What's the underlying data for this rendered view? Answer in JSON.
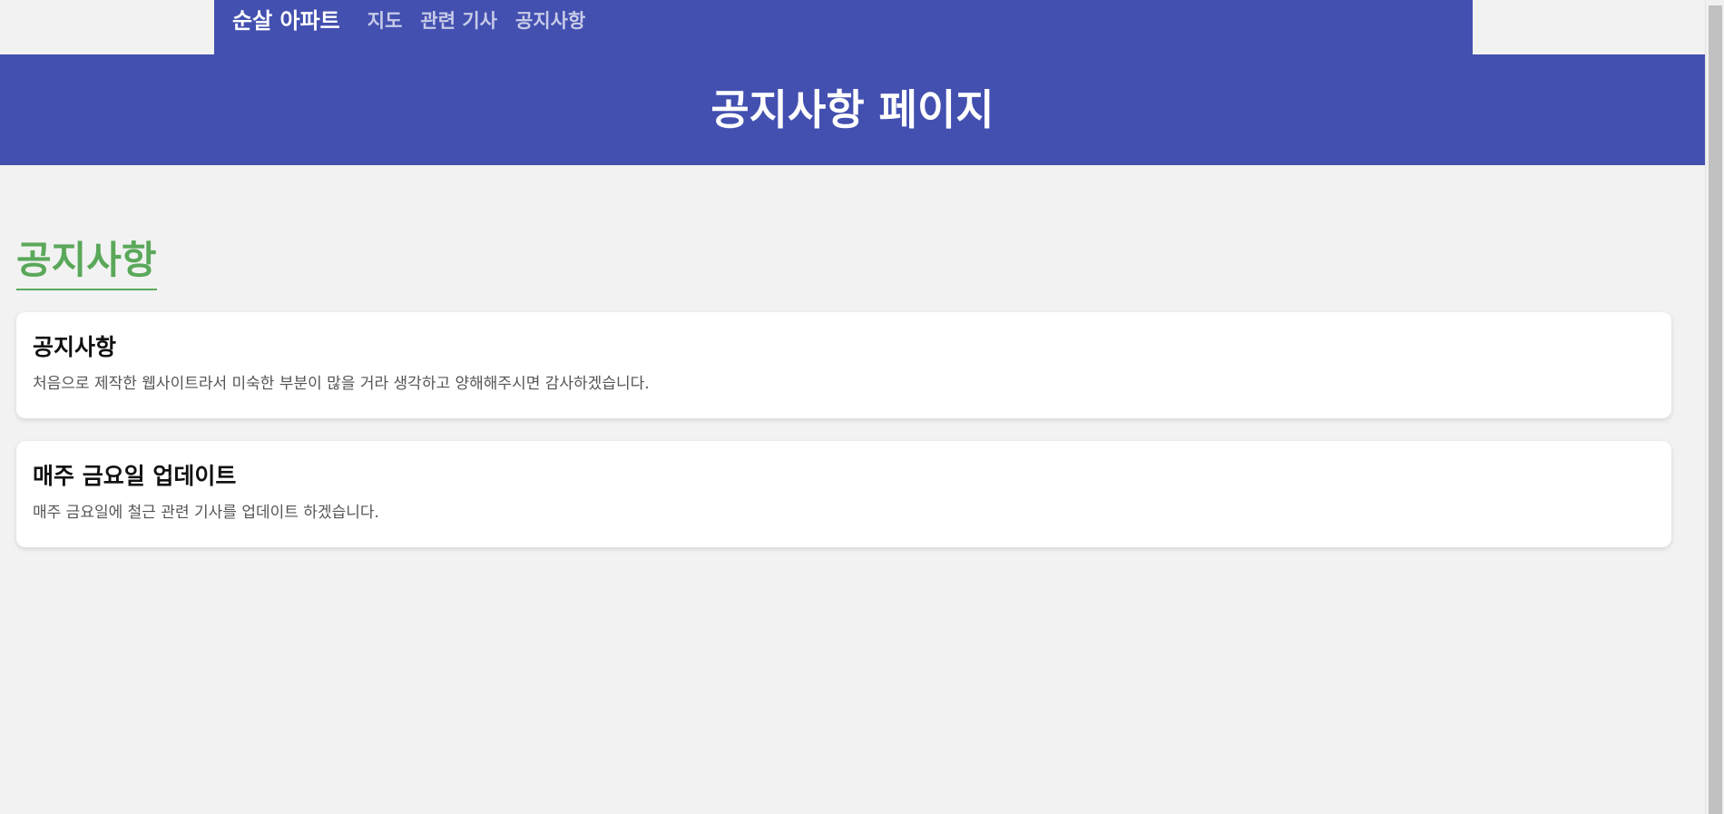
{
  "nav": {
    "brand": "순살 아파트",
    "links": [
      "지도",
      "관련 기사",
      "공지사항"
    ]
  },
  "banner": {
    "title": "공지사항 페이지"
  },
  "section": {
    "title": "공지사항"
  },
  "notices": [
    {
      "title": "공지사항",
      "body": "처음으로 제작한 웹사이트라서 미숙한 부분이 많을 거라 생각하고 양해해주시면 감사하겠습니다."
    },
    {
      "title": "매주 금요일 업데이트",
      "body": "매주 금요일에 철근 관련 기사를 업데이트 하겠습니다."
    }
  ],
  "colors": {
    "primary": "#4350b0",
    "accent": "#5aa85a",
    "background": "#f2f2f2"
  }
}
